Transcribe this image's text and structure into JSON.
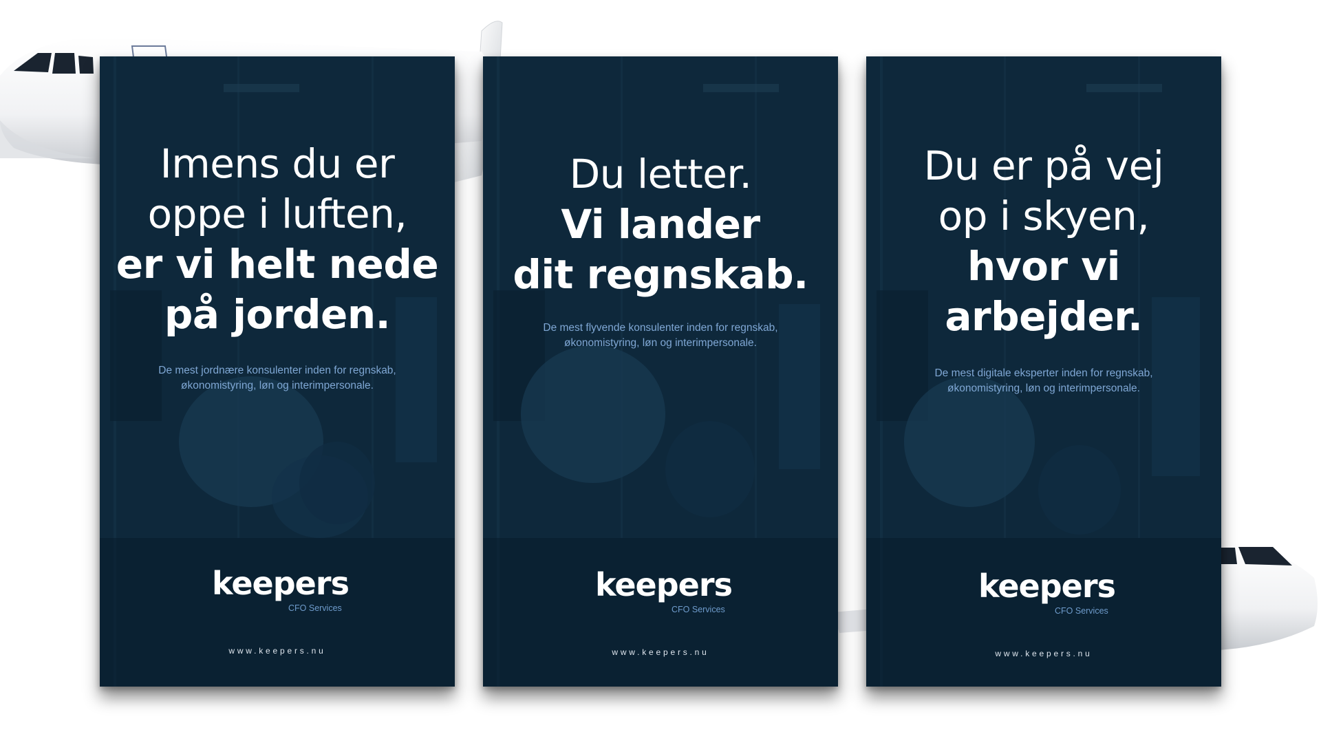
{
  "colors": {
    "poster_background": "#0c2436",
    "headline": "#ffffff",
    "subtext": "#7fa7d4",
    "logo_sub": "#6f9ccc",
    "page_background": "#ffffff"
  },
  "posters": [
    {
      "headline_light": [
        "Imens du er",
        "oppe i luften,"
      ],
      "headline_bold": [
        "er vi helt nede",
        "på jorden."
      ],
      "subtext": [
        "De mest jordnære konsulenter inden for regnskab,",
        "økonomistyring, løn og interimpersonale."
      ],
      "logo_word": "keepers",
      "logo_sub": "CFO Services",
      "website": "www.keepers.nu"
    },
    {
      "headline_light": [
        "Du letter."
      ],
      "headline_bold": [
        "Vi lander",
        "dit regnskab."
      ],
      "subtext": [
        "De mest flyvende konsulenter inden for regnskab,",
        "økonomistyring, løn og interimpersonale."
      ],
      "logo_word": "keepers",
      "logo_sub": "CFO Services",
      "website": "www.keepers.nu"
    },
    {
      "headline_light": [
        "Du er på vej",
        "op i skyen,"
      ],
      "headline_bold": [
        "hvor vi",
        "arbejder."
      ],
      "subtext": [
        "De mest digitale eksperter inden for regnskab,",
        "økonomistyring, løn og interimpersonale."
      ],
      "logo_word": "keepers",
      "logo_sub": "CFO Services",
      "website": "www.keepers.nu"
    }
  ]
}
